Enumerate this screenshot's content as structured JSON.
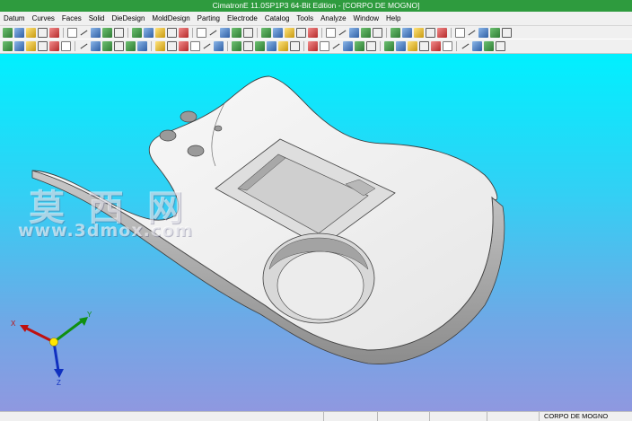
{
  "window": {
    "title": "CimatronE 11.0SP1P3 64-Bit Edition - [CORPO DE MOGNO]"
  },
  "menu": {
    "items": [
      "Datum",
      "Curves",
      "Faces",
      "Solid",
      "DieDesign",
      "MoldDesign",
      "Parting",
      "Electrode",
      "Catalog",
      "Tools",
      "Analyze",
      "Window",
      "Help"
    ]
  },
  "toolbar": {
    "row1_icons": [
      "new-icon",
      "open-icon",
      "save-icon",
      "undo-icon",
      "redo-icon",
      "zoom-icon",
      "pan-icon",
      "rotate-icon",
      "shade-icon",
      "wireframe-icon",
      "layer-icon",
      "color-icon",
      "light-icon",
      "filter-icon",
      "select-icon",
      "render-icon",
      "display-icon",
      "view-icon",
      "section-icon",
      "measure-icon",
      "draft-icon",
      "curvature-icon",
      "point-icon",
      "line-icon",
      "arc-icon",
      "spline-icon",
      "plane-icon",
      "axis-icon",
      "ucs-icon",
      "grid-icon",
      "snap-icon",
      "mirror-icon",
      "copy-icon",
      "move-icon",
      "scale-icon",
      "delete-icon",
      "hide-icon",
      "show-icon",
      "group-icon",
      "settings-icon"
    ],
    "row2_icons": [
      "extrude-icon",
      "revolve-icon",
      "sweep-icon",
      "loft-icon",
      "fillet-icon",
      "chamfer-icon",
      "shell-icon",
      "draft-solid-icon",
      "boolean-icon",
      "split-icon",
      "offset-icon",
      "trim-icon",
      "extend-icon",
      "blend-icon",
      "sketch-icon",
      "dimension-icon",
      "constraint-icon",
      "pattern-icon",
      "hole-icon",
      "rib-icon"
    ]
  },
  "viewport": {
    "model_name": "CORPO DE MOGNO",
    "background_top": "#00f0ff",
    "background_bottom": "#8f98e0",
    "watermark_cn": "莫 西 网",
    "watermark_url": "www.3dmox.com"
  },
  "triad": {
    "x_label": "X",
    "y_label": "Y",
    "z_label": "Z",
    "x_color": "#c01010",
    "y_color": "#109010",
    "z_color": "#1030c0"
  },
  "status": {
    "document_name": "CORPO DE MOGNO"
  }
}
